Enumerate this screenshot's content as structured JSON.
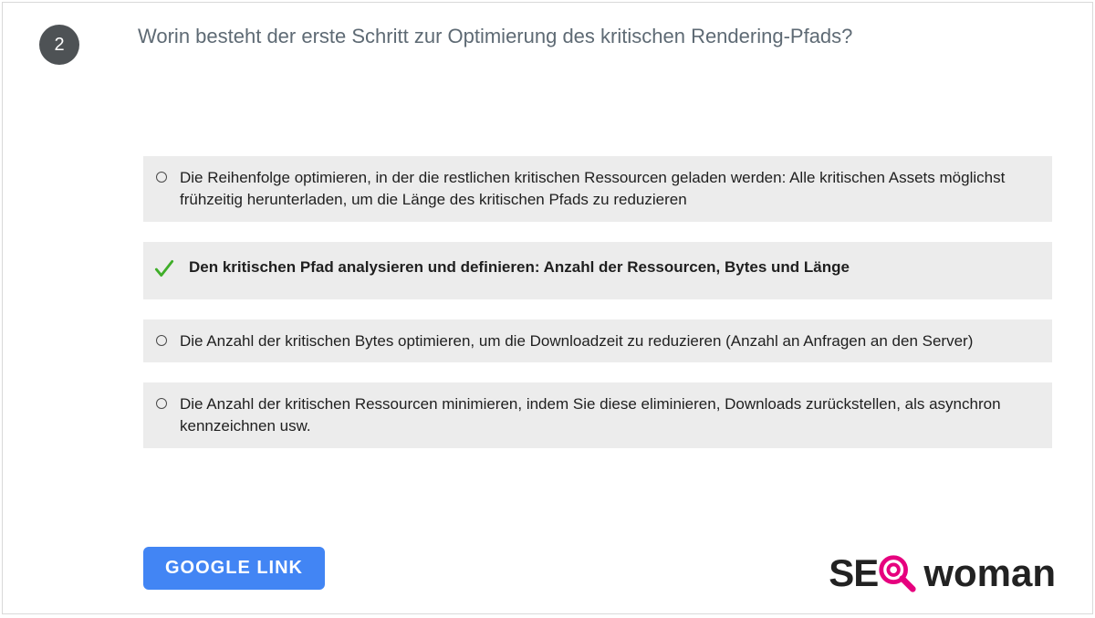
{
  "question": {
    "number": "2",
    "text": "Worin besteht der erste Schritt zur Optimierung des kritischen Rendering-Pfads?"
  },
  "options": [
    {
      "label": "Die Reihenfolge optimieren, in der die restlichen kritischen Ressourcen geladen werden: Alle kritischen Assets möglichst frühzeitig herunterladen, um die Länge des kritischen Pfads zu reduzieren",
      "correct": false
    },
    {
      "label": "Den kritischen Pfad analysieren und definieren: Anzahl der Ressourcen, Bytes und Länge",
      "correct": true
    },
    {
      "label": "Die Anzahl der kritischen Bytes optimieren, um die Downloadzeit zu reduzieren (Anzahl an Anfragen an den Server)",
      "correct": false
    },
    {
      "label": "Die Anzahl der kritischen Ressourcen minimieren, indem Sie diese eliminieren, Downloads zurückstellen, als asynchron kennzeichnen usw.",
      "correct": false
    }
  ],
  "button": {
    "label": "GOOGLE   LINK"
  },
  "logo": {
    "part1": "SE",
    "part2": "woman"
  },
  "colors": {
    "accent_pink": "#e6007e",
    "button_blue": "#4285f4",
    "check_green": "#3fae29"
  }
}
